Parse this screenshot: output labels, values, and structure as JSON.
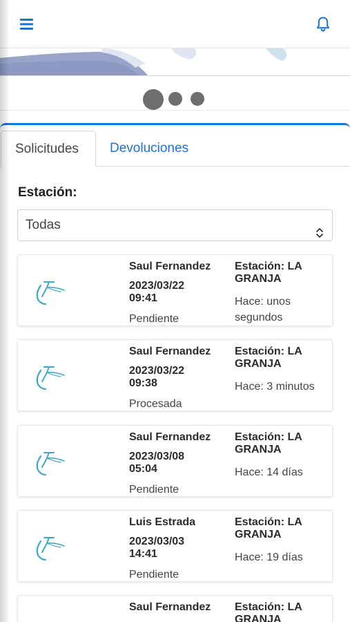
{
  "header": {
    "menu_icon": "hamburger-menu-icon",
    "notification_icon": "bell-icon",
    "accent_color": "#1a73d9"
  },
  "carousel": {
    "indicator_count": 3,
    "active_index": 0
  },
  "tabs": [
    {
      "label": "Solicitudes",
      "active": true
    },
    {
      "label": "Devoluciones",
      "active": false
    }
  ],
  "filter": {
    "label": "Estación:",
    "selected": "Todas"
  },
  "requests": [
    {
      "name": "Saul Fernandez",
      "date": "2023/03/22",
      "time": "09:41",
      "status": "Pendiente",
      "station": "Estación: LA GRANJA",
      "ago": "Hace: unos segundos"
    },
    {
      "name": "Saul Fernandez",
      "date": "2023/03/22",
      "time": "09:38",
      "status": "Procesada",
      "station": "Estación: LA GRANJA",
      "ago": "Hace: 3 minutos"
    },
    {
      "name": "Saul Fernandez",
      "date": "2023/03/08",
      "time": "05:04",
      "status": "Pendiente",
      "station": "Estación: LA GRANJA",
      "ago": "Hace: 14 días"
    },
    {
      "name": "Luis Estrada",
      "date": "2023/03/03",
      "time": "14:41",
      "status": "Pendiente",
      "station": "Estación: LA GRANJA",
      "ago": "Hace: 19 días"
    },
    {
      "name": "Saul Fernandez",
      "date": "",
      "time": "",
      "status": "",
      "station": "Estación: LA GRANJA",
      "ago": ""
    }
  ]
}
